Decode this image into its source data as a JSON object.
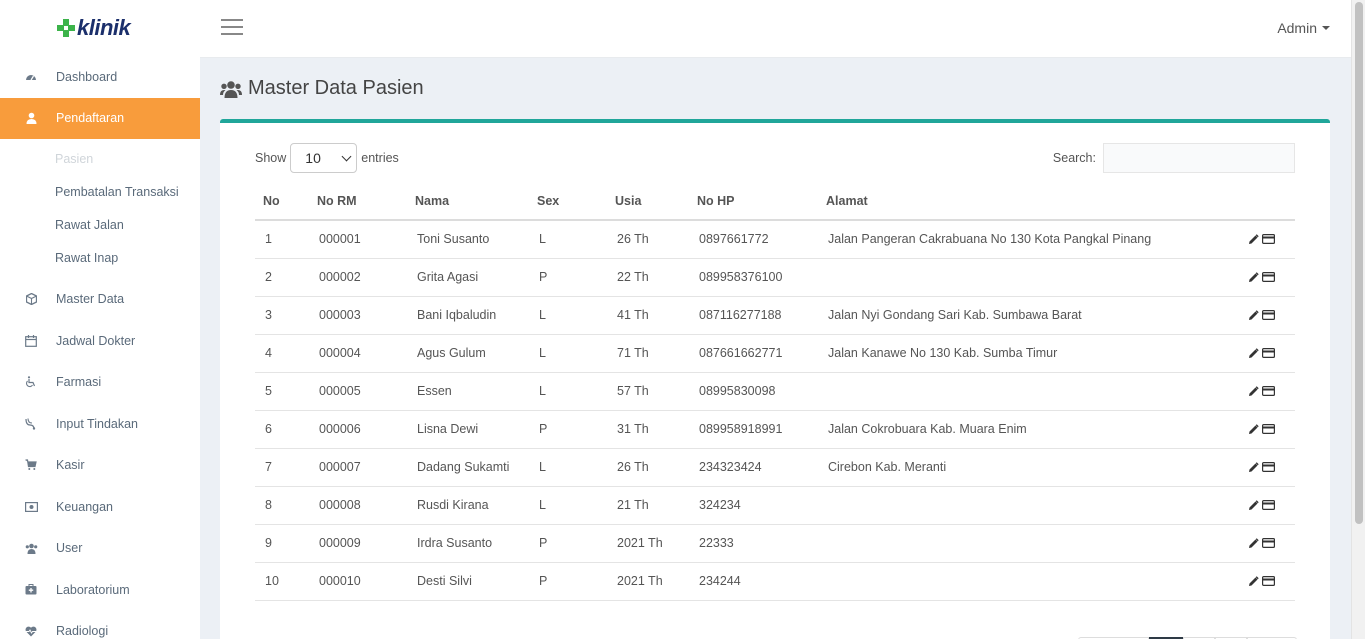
{
  "app": {
    "logo_text": "klinik"
  },
  "sidebar": {
    "items": [
      {
        "label": "Dashboard",
        "icon": "dashboard-icon"
      },
      {
        "label": "Pendaftaran",
        "icon": "user-icon",
        "active": true
      },
      {
        "label": "Master Data",
        "icon": "cube-icon"
      },
      {
        "label": "Jadwal Dokter",
        "icon": "calendar-icon"
      },
      {
        "label": "Farmasi",
        "icon": "wheelchair-icon"
      },
      {
        "label": "Input Tindakan",
        "icon": "stethoscope-icon"
      },
      {
        "label": "Kasir",
        "icon": "cart-icon"
      },
      {
        "label": "Keuangan",
        "icon": "money-icon"
      },
      {
        "label": "User",
        "icon": "users-icon"
      },
      {
        "label": "Laboratorium",
        "icon": "medkit-icon"
      },
      {
        "label": "Radiologi",
        "icon": "heartbeat-icon"
      }
    ],
    "submenu": [
      "Pasien",
      "Pembatalan Transaksi",
      "Rawat Jalan",
      "Rawat Inap"
    ]
  },
  "topbar": {
    "user": "Admin"
  },
  "page": {
    "title": "Master Data Pasien"
  },
  "table_controls": {
    "show_label": "Show",
    "entries_value": "10",
    "entries_label": "entries",
    "search_label": "Search:",
    "search_value": ""
  },
  "table": {
    "headers": [
      "No",
      "No RM",
      "Nama",
      "Sex",
      "Usia",
      "No HP",
      "Alamat"
    ],
    "rows": [
      [
        "1",
        "000001",
        "Toni Susanto",
        "L",
        "26 Th",
        "0897661772",
        "Jalan Pangeran Cakrabuana No 130 Kota Pangkal Pinang"
      ],
      [
        "2",
        "000002",
        "Grita Agasi",
        "P",
        "22 Th",
        "089958376100",
        ""
      ],
      [
        "3",
        "000003",
        "Bani Iqbaludin",
        "L",
        "41 Th",
        "087116277188",
        "Jalan Nyi Gondang Sari Kab. Sumbawa Barat"
      ],
      [
        "4",
        "000004",
        "Agus Gulum",
        "L",
        "71 Th",
        "087661662771",
        "Jalan Kanawe No 130 Kab. Sumba Timur"
      ],
      [
        "5",
        "000005",
        "Essen",
        "L",
        "57 Th",
        "08995830098",
        ""
      ],
      [
        "6",
        "000006",
        "Lisna Dewi",
        "P",
        "31 Th",
        "089958918991",
        "Jalan Cokrobuara Kab. Muara Enim"
      ],
      [
        "7",
        "000007",
        "Dadang Sukamti",
        "L",
        "26 Th",
        "234323424",
        "Cirebon Kab. Meranti"
      ],
      [
        "8",
        "000008",
        "Rusdi Kirana",
        "L",
        "21 Th",
        "324234",
        ""
      ],
      [
        "9",
        "000009",
        "Irdra Susanto",
        "P",
        "2021 Th",
        "22333",
        ""
      ],
      [
        "10",
        "000010",
        "Desti Silvi",
        "P",
        "2021 Th",
        "234244",
        ""
      ]
    ]
  },
  "colors": {
    "accent": "#f89c3c",
    "card_border": "#20a69a",
    "logo_green": "#3cb34a",
    "logo_navy": "#1b2f6b"
  }
}
